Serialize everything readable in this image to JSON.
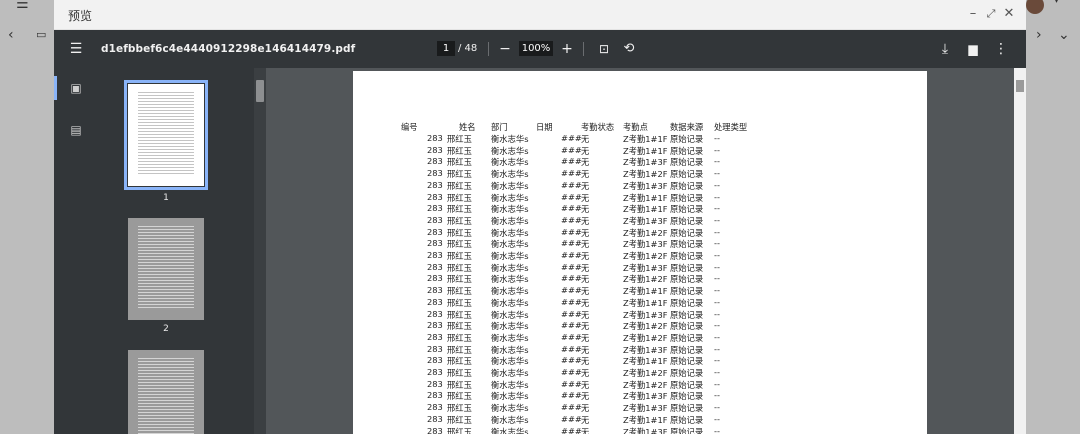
{
  "modal": {
    "title": "预览"
  },
  "toolbar": {
    "filename": "d1efbbef6c4e4440912298e146414479.pdf",
    "page_current": "1",
    "page_total": "/ 48",
    "zoom": "100%"
  },
  "thumbnails": [
    {
      "label": "1",
      "selected": true
    },
    {
      "label": "2",
      "selected": false
    },
    {
      "label": "",
      "selected": false
    }
  ],
  "table": {
    "headers": [
      "编号",
      "姓名",
      "部门",
      "日期",
      "考勤状态",
      "考勤点",
      "数据来源",
      "处理类型"
    ],
    "rows": [
      [
        "283",
        "邢红玉",
        "衡水志华s",
        "###",
        "无",
        "Z考勤1#1F",
        "原始记录",
        "--"
      ],
      [
        "283",
        "邢红玉",
        "衡水志华s",
        "###",
        "无",
        "Z考勤1#1F",
        "原始记录",
        "--"
      ],
      [
        "283",
        "邢红玉",
        "衡水志华s",
        "###",
        "无",
        "Z考勤1#3F",
        "原始记录",
        "--"
      ],
      [
        "283",
        "邢红玉",
        "衡水志华s",
        "###",
        "无",
        "Z考勤1#2F",
        "原始记录",
        "--"
      ],
      [
        "283",
        "邢红玉",
        "衡水志华s",
        "###",
        "无",
        "Z考勤1#3F",
        "原始记录",
        "--"
      ],
      [
        "283",
        "邢红玉",
        "衡水志华s",
        "###",
        "无",
        "Z考勤1#1F",
        "原始记录",
        "--"
      ],
      [
        "283",
        "邢红玉",
        "衡水志华s",
        "###",
        "无",
        "Z考勤1#1F",
        "原始记录",
        "--"
      ],
      [
        "283",
        "邢红玉",
        "衡水志华s",
        "###",
        "无",
        "Z考勤1#3F",
        "原始记录",
        "--"
      ],
      [
        "283",
        "邢红玉",
        "衡水志华s",
        "###",
        "无",
        "Z考勤1#2F",
        "原始记录",
        "--"
      ],
      [
        "283",
        "邢红玉",
        "衡水志华s",
        "###",
        "无",
        "Z考勤1#3F",
        "原始记录",
        "--"
      ],
      [
        "283",
        "邢红玉",
        "衡水志华s",
        "###",
        "无",
        "Z考勤1#2F",
        "原始记录",
        "--"
      ],
      [
        "283",
        "邢红玉",
        "衡水志华s",
        "###",
        "无",
        "Z考勤1#3F",
        "原始记录",
        "--"
      ],
      [
        "283",
        "邢红玉",
        "衡水志华s",
        "###",
        "无",
        "Z考勤1#2F",
        "原始记录",
        "--"
      ],
      [
        "283",
        "邢红玉",
        "衡水志华s",
        "###",
        "无",
        "Z考勤1#1F",
        "原始记录",
        "--"
      ],
      [
        "283",
        "邢红玉",
        "衡水志华s",
        "###",
        "无",
        "Z考勤1#1F",
        "原始记录",
        "--"
      ],
      [
        "283",
        "邢红玉",
        "衡水志华s",
        "###",
        "无",
        "Z考勤1#3F",
        "原始记录",
        "--"
      ],
      [
        "283",
        "邢红玉",
        "衡水志华s",
        "###",
        "无",
        "Z考勤1#2F",
        "原始记录",
        "--"
      ],
      [
        "283",
        "邢红玉",
        "衡水志华s",
        "###",
        "无",
        "Z考勤1#2F",
        "原始记录",
        "--"
      ],
      [
        "283",
        "邢红玉",
        "衡水志华s",
        "###",
        "无",
        "Z考勤1#3F",
        "原始记录",
        "--"
      ],
      [
        "283",
        "邢红玉",
        "衡水志华s",
        "###",
        "无",
        "Z考勤1#1F",
        "原始记录",
        "--"
      ],
      [
        "283",
        "邢红玉",
        "衡水志华s",
        "###",
        "无",
        "Z考勤1#2F",
        "原始记录",
        "--"
      ],
      [
        "283",
        "邢红玉",
        "衡水志华s",
        "###",
        "无",
        "Z考勤1#2F",
        "原始记录",
        "--"
      ],
      [
        "283",
        "邢红玉",
        "衡水志华s",
        "###",
        "无",
        "Z考勤1#3F",
        "原始记录",
        "--"
      ],
      [
        "283",
        "邢红玉",
        "衡水志华s",
        "###",
        "无",
        "Z考勤1#3F",
        "原始记录",
        "--"
      ],
      [
        "283",
        "邢红玉",
        "衡水志华s",
        "###",
        "无",
        "Z考勤1#1F",
        "原始记录",
        "--"
      ],
      [
        "283",
        "邢红玉",
        "衡水志华s",
        "###",
        "无",
        "Z考勤1#3F",
        "原始记录",
        "--"
      ]
    ]
  }
}
